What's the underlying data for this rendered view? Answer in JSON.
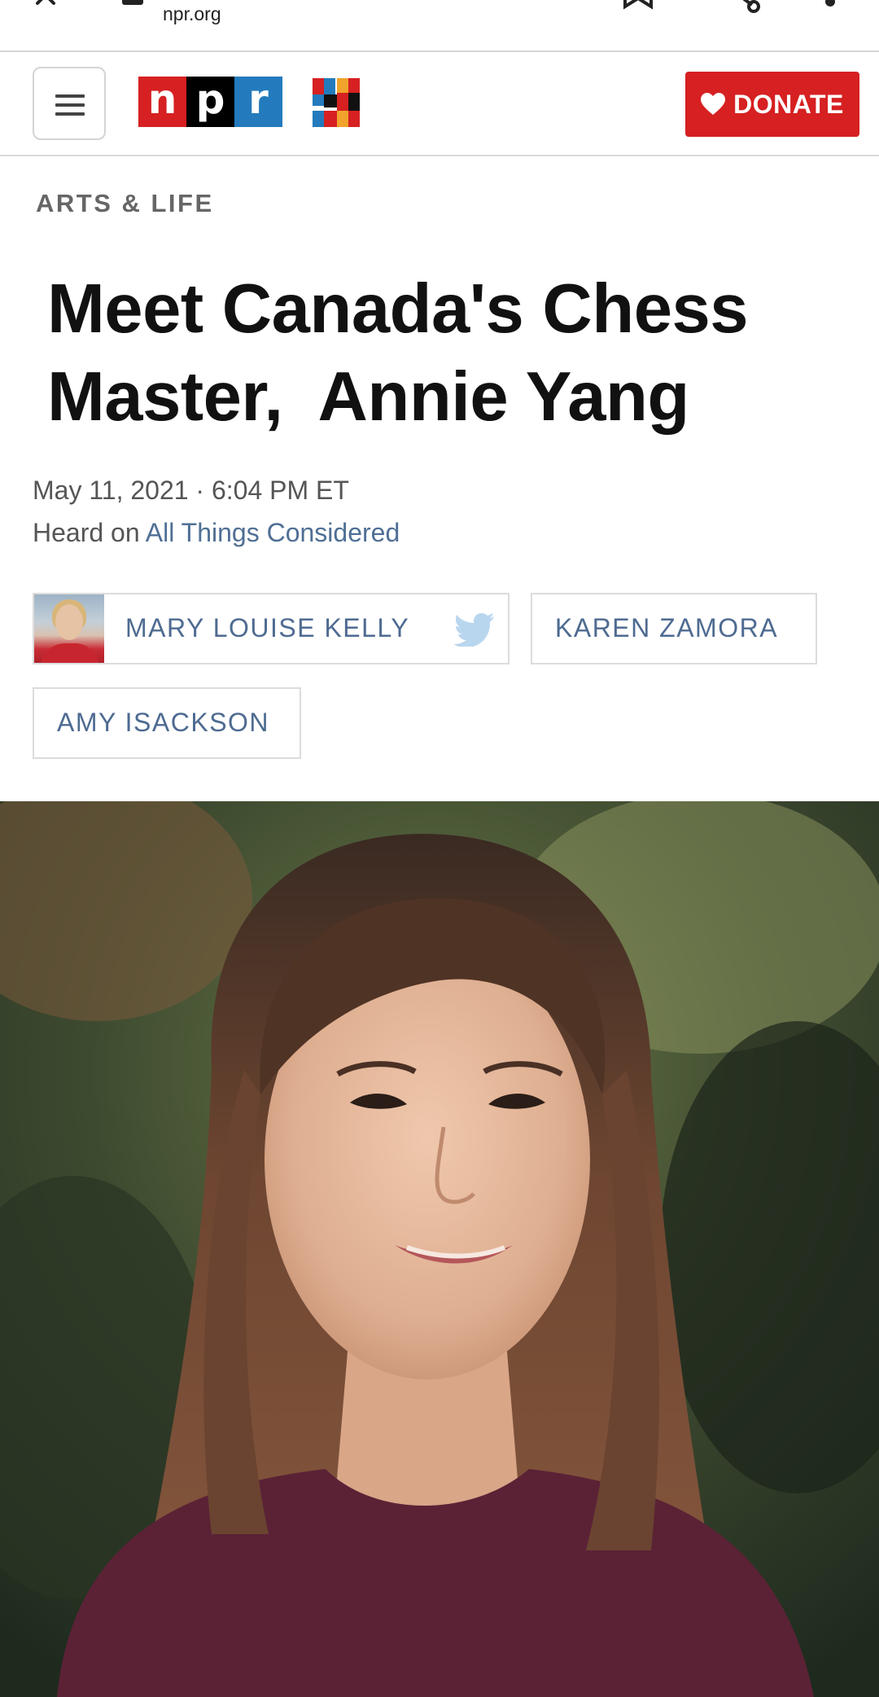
{
  "browser": {
    "url": "npr.org",
    "icons": [
      "close-icon",
      "lock-icon",
      "bookmark-icon",
      "share-icon",
      "more-icon"
    ]
  },
  "header": {
    "menu_icon": "hamburger-icon",
    "logo_letters": [
      "n",
      "p",
      "r"
    ],
    "logo_colors": [
      "#d62021",
      "#000000",
      "#237bbd"
    ],
    "anniversary_icon": "npr-50-icon",
    "donate_label": "DONATE",
    "donate_color": "#d62021",
    "donate_icon": "heart-icon"
  },
  "article": {
    "section": "ARTS & LIFE",
    "headline": "Meet Canada's Chess\nMaster,  Annie Yang",
    "date": "May 11, 2021 · 6:04 PM ET",
    "heard_on_prefix": "Heard on ",
    "program": "All Things Considered",
    "bylines": [
      {
        "name": "MARY LOUISE KELLY",
        "has_avatar": true,
        "icon": "twitter-icon"
      },
      {
        "name": "KAREN ZAMORA"
      },
      {
        "name": "AMY ISACKSON"
      }
    ]
  },
  "colors": {
    "link": "#4f6f95",
    "section": "#666666",
    "headline": "#111111"
  }
}
